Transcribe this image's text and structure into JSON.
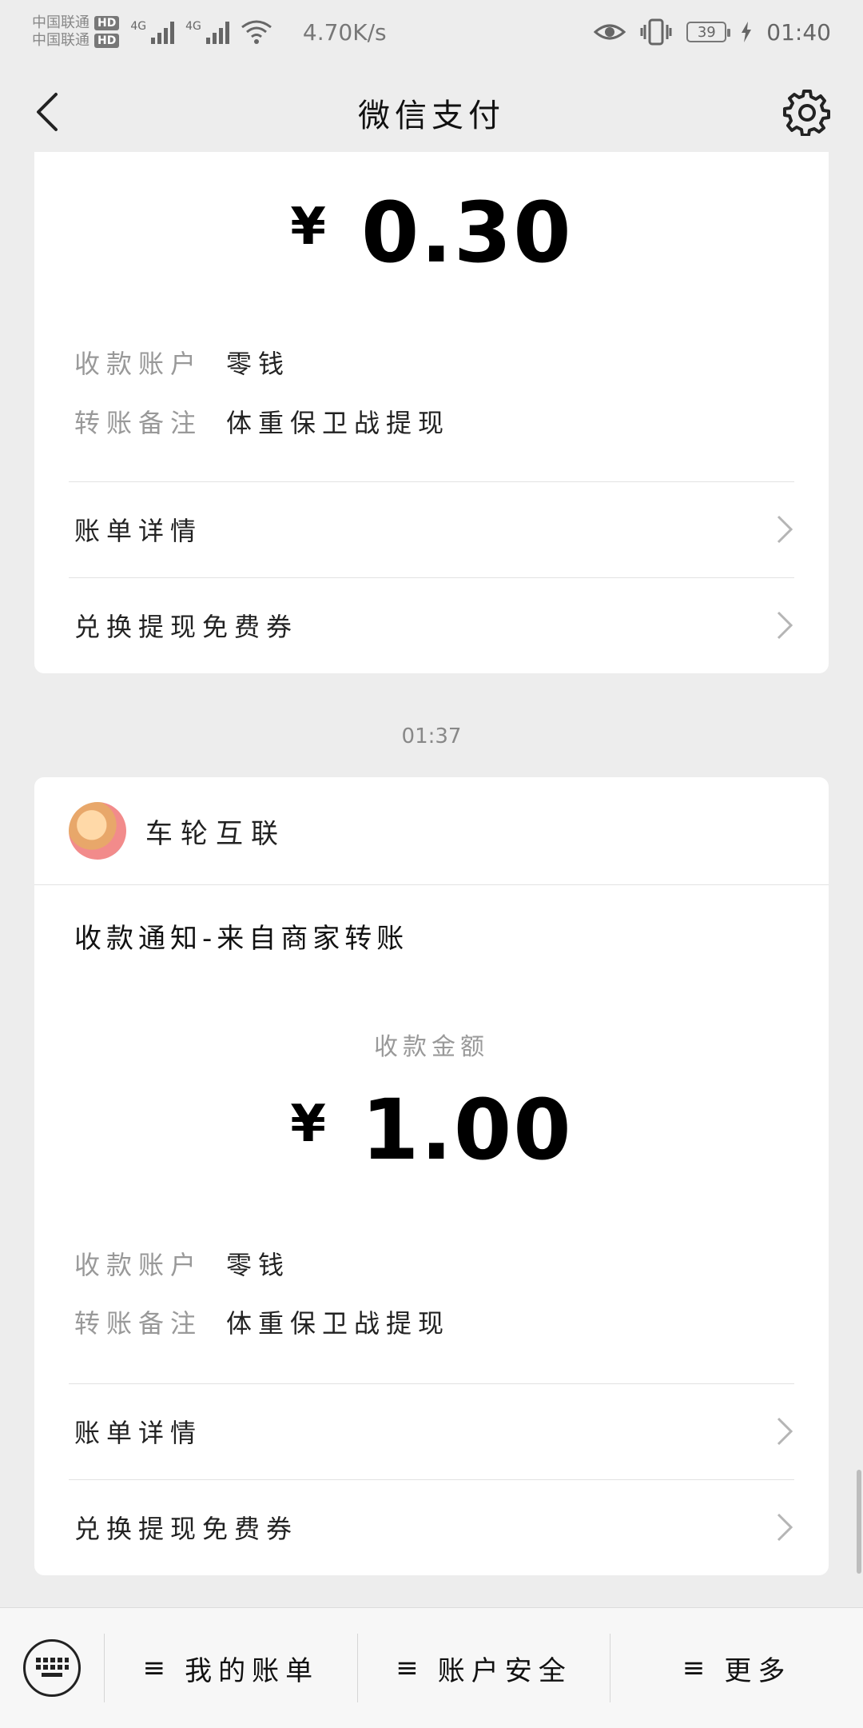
{
  "status_bar": {
    "carrier_1": "中国联通",
    "carrier_2": "中国联通",
    "hd_badge": "HD",
    "net_1": "4G",
    "net_2": "4G",
    "speed": "4.70K/s",
    "battery": "39",
    "time": "01:40"
  },
  "nav": {
    "title": "微信支付",
    "back_icon": "chevron-left-icon",
    "settings_icon": "gear-icon"
  },
  "cards": [
    {
      "amount_symbol": "¥",
      "amount_value": "0.30",
      "account_label": "收款账户",
      "account_value": "零钱",
      "remark_label": "转账备注",
      "remark_value": "体重保卫战提现",
      "link_1": "账单详情",
      "link_2": "兑换提现免费券"
    },
    {
      "merchant_name": "车轮互联",
      "notice_title": "收款通知-来自商家转账",
      "amount_label": "收款金额",
      "amount_symbol": "¥",
      "amount_value": "1.00",
      "account_label": "收款账户",
      "account_value": "零钱",
      "remark_label": "转账备注",
      "remark_value": "体重保卫战提现",
      "link_1": "账单详情",
      "link_2": "兑换提现免费券"
    }
  ],
  "time_separator": "01:37",
  "bottom_menu": {
    "keyboard_icon": "keyboard-icon",
    "item_1": "我的账单",
    "item_2": "账户安全",
    "item_3": "更多",
    "burger_glyph": "≡"
  }
}
